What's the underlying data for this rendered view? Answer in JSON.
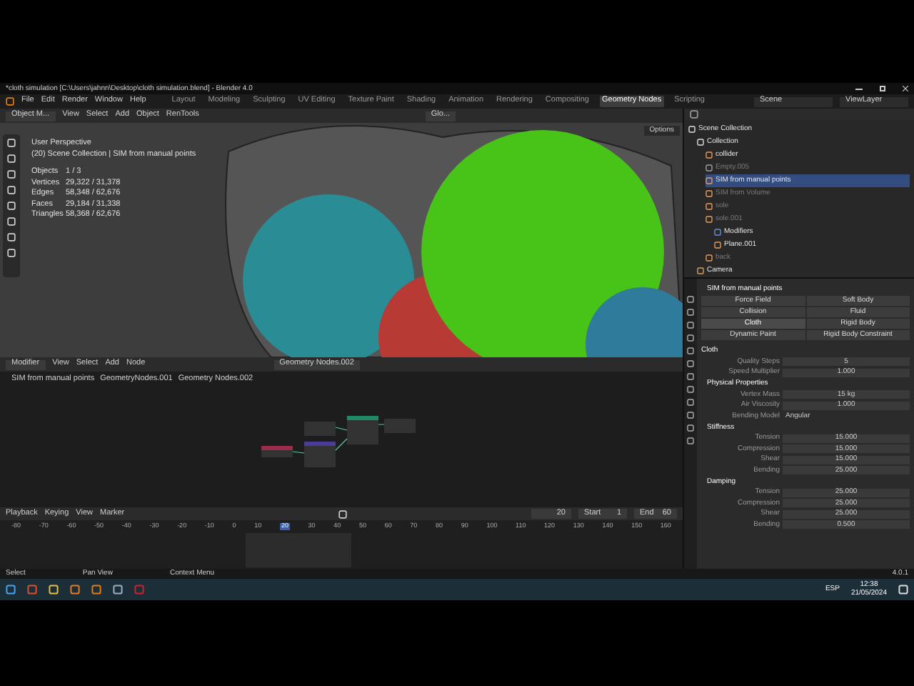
{
  "window": {
    "title": "*cloth simulation [C:\\Users\\jahnn\\Desktop\\cloth simulation.blend] - Blender 4.0"
  },
  "menu": [
    "File",
    "Edit",
    "Render",
    "Window",
    "Help"
  ],
  "workspaces": [
    {
      "label": "Layout",
      "selected": false
    },
    {
      "label": "Modeling",
      "selected": false
    },
    {
      "label": "Sculpting",
      "selected": false
    },
    {
      "label": "UV Editing",
      "selected": false
    },
    {
      "label": "Texture Paint",
      "selected": false
    },
    {
      "label": "Shading",
      "selected": false
    },
    {
      "label": "Animation",
      "selected": false
    },
    {
      "label": "Rendering",
      "selected": false
    },
    {
      "label": "Compositing",
      "selected": false
    },
    {
      "label": "Geometry Nodes",
      "selected": true
    },
    {
      "label": "Scripting",
      "selected": false
    }
  ],
  "scene": "Scene",
  "view_layer": "ViewLayer",
  "viewport": {
    "mode": "Object M...",
    "menu": [
      "View",
      "Select",
      "Add",
      "Object",
      "RenTools"
    ],
    "orientation": "Glo...",
    "options": "Options",
    "perspective": "User Perspective",
    "context": "(20) Scene Collection | SIM from manual points",
    "stats": [
      {
        "label": "Objects",
        "value": "1 / 3"
      },
      {
        "label": "Vertices",
        "value": "29,322 / 31,378"
      },
      {
        "label": "Edges",
        "value": "58,348 / 62,676"
      },
      {
        "label": "Faces",
        "value": "29,184 / 31,338"
      },
      {
        "label": "Triangles",
        "value": "58,368 / 62,676"
      }
    ]
  },
  "node_editor": {
    "mode": "Modifier",
    "menu": [
      "View",
      "Select",
      "Add",
      "Node"
    ],
    "tree": "Geometry Nodes.002",
    "breadcrumbs": [
      "SIM from manual points",
      "GeometryNodes.001",
      "Geometry Nodes.002"
    ]
  },
  "timeline": {
    "menu": [
      "Playback",
      "Keying",
      "View",
      "Marker"
    ],
    "frame": "20",
    "start_label": "Start",
    "start": "1",
    "end_label": "End",
    "end": "60",
    "ticks": [
      {
        "label": "-80",
        "selected": false
      },
      {
        "label": "-70",
        "selected": false
      },
      {
        "label": "-60",
        "selected": false
      },
      {
        "label": "-50",
        "selected": false
      },
      {
        "label": "-40",
        "selected": false
      },
      {
        "label": "-30",
        "selected": false
      },
      {
        "label": "-20",
        "selected": false
      },
      {
        "label": "-10",
        "selected": false
      },
      {
        "label": "0",
        "selected": false
      },
      {
        "label": "10",
        "selected": false
      },
      {
        "label": "20",
        "selected": true
      },
      {
        "label": "30",
        "selected": false
      },
      {
        "label": "40",
        "selected": false
      },
      {
        "label": "50",
        "selected": false
      },
      {
        "label": "60",
        "selected": false
      },
      {
        "label": "70",
        "selected": false
      },
      {
        "label": "80",
        "selected": false
      },
      {
        "label": "90",
        "selected": false
      },
      {
        "label": "100",
        "selected": false
      },
      {
        "label": "110",
        "selected": false
      },
      {
        "label": "120",
        "selected": false
      },
      {
        "label": "130",
        "selected": false
      },
      {
        "label": "140",
        "selected": false
      },
      {
        "label": "150",
        "selected": false
      },
      {
        "label": "160",
        "selected": false
      }
    ]
  },
  "outliner": {
    "items": [
      {
        "label": "Scene Collection",
        "kind": "collection",
        "selected": false,
        "hidden": false,
        "children": [
          {
            "label": "Collection",
            "kind": "collection",
            "selected": false,
            "hidden": false,
            "children": [
              {
                "label": "collider",
                "kind": "mesh",
                "selected": false,
                "hidden": false
              },
              {
                "label": "Empty.005",
                "kind": "empty",
                "selected": false,
                "hidden": true
              },
              {
                "label": "SIM from manual points",
                "kind": "mesh",
                "selected": true,
                "hidden": false
              },
              {
                "label": "SIM from Volume",
                "kind": "mesh",
                "selected": false,
                "hidden": true
              },
              {
                "label": "sole",
                "kind": "mesh",
                "selected": false,
                "hidden": true
              },
              {
                "label": "sole.001",
                "kind": "mesh",
                "selected": false,
                "hidden": true,
                "children": [
                  {
                    "label": "Modifiers",
                    "kind": "modifier",
                    "selected": false,
                    "hidden": false
                  },
                  {
                    "label": "Plane.001",
                    "kind": "mesh",
                    "selected": false,
                    "hidden": false
                  }
                ]
              },
              {
                "label": "back",
                "kind": "mesh",
                "selected": false,
                "hidden": true
              }
            ]
          },
          {
            "label": "Camera",
            "kind": "camera",
            "selected": false,
            "hidden": false
          }
        ]
      }
    ]
  },
  "properties": {
    "object": "SIM from manual points",
    "physics": [
      {
        "label": "Force Field",
        "enabled": false
      },
      {
        "label": "Soft Body",
        "enabled": false
      },
      {
        "label": "Collision",
        "enabled": false
      },
      {
        "label": "Fluid",
        "enabled": false
      },
      {
        "label": "Cloth",
        "enabled": true
      },
      {
        "label": "Rigid Body",
        "enabled": false
      },
      {
        "label": "Dynamic Paint",
        "enabled": false
      },
      {
        "label": "Rigid Body Constraint",
        "enabled": false
      }
    ],
    "panel": "Cloth",
    "sections": [
      {
        "fields": [
          {
            "label": "Quality Steps",
            "value": "5"
          },
          {
            "label": "Speed Multiplier",
            "value": "1.000"
          }
        ]
      },
      {
        "title": "Physical Properties",
        "fields": [
          {
            "label": "Vertex Mass",
            "value": "15 kg"
          },
          {
            "label": "Air Viscosity",
            "value": "1.000"
          },
          {
            "label": "Bending Model",
            "value": "Angular",
            "kind": "dropdown"
          }
        ]
      },
      {
        "title": "Stiffness",
        "fields": [
          {
            "label": "Tension",
            "value": "15.000"
          },
          {
            "label": "Compression",
            "value": "15.000"
          },
          {
            "label": "Shear",
            "value": "15.000"
          },
          {
            "label": "Bending",
            "value": "25.000"
          }
        ]
      },
      {
        "title": "Damping",
        "fields": [
          {
            "label": "Tension",
            "value": "25.000"
          },
          {
            "label": "Compression",
            "value": "25.000"
          },
          {
            "label": "Shear",
            "value": "25.000"
          },
          {
            "label": "Bending",
            "value": "0.500"
          }
        ]
      }
    ]
  },
  "status_bar": {
    "hints": [
      "Select",
      "Pan View",
      "Context Menu"
    ],
    "version": "4.0.1"
  },
  "taskbar": {
    "language": "ESP",
    "time": "12:38",
    "date": "21/05/2024"
  }
}
